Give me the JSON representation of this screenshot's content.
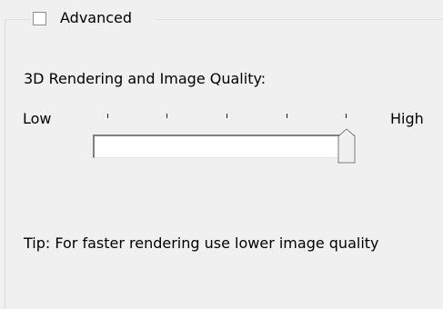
{
  "advanced": {
    "checkbox_label": "Advanced",
    "checked": false
  },
  "quality": {
    "label": "3D Rendering and Image Quality:",
    "low_label": "Low",
    "high_label": "High",
    "slider_level": 1.0,
    "tick_count": 5
  },
  "tip": {
    "text": "Tip: For faster rendering use lower image quality"
  },
  "colors": {
    "background": "#f0f0f0",
    "group_border": "#d5dfe5",
    "track_fill": "#ffffff"
  }
}
